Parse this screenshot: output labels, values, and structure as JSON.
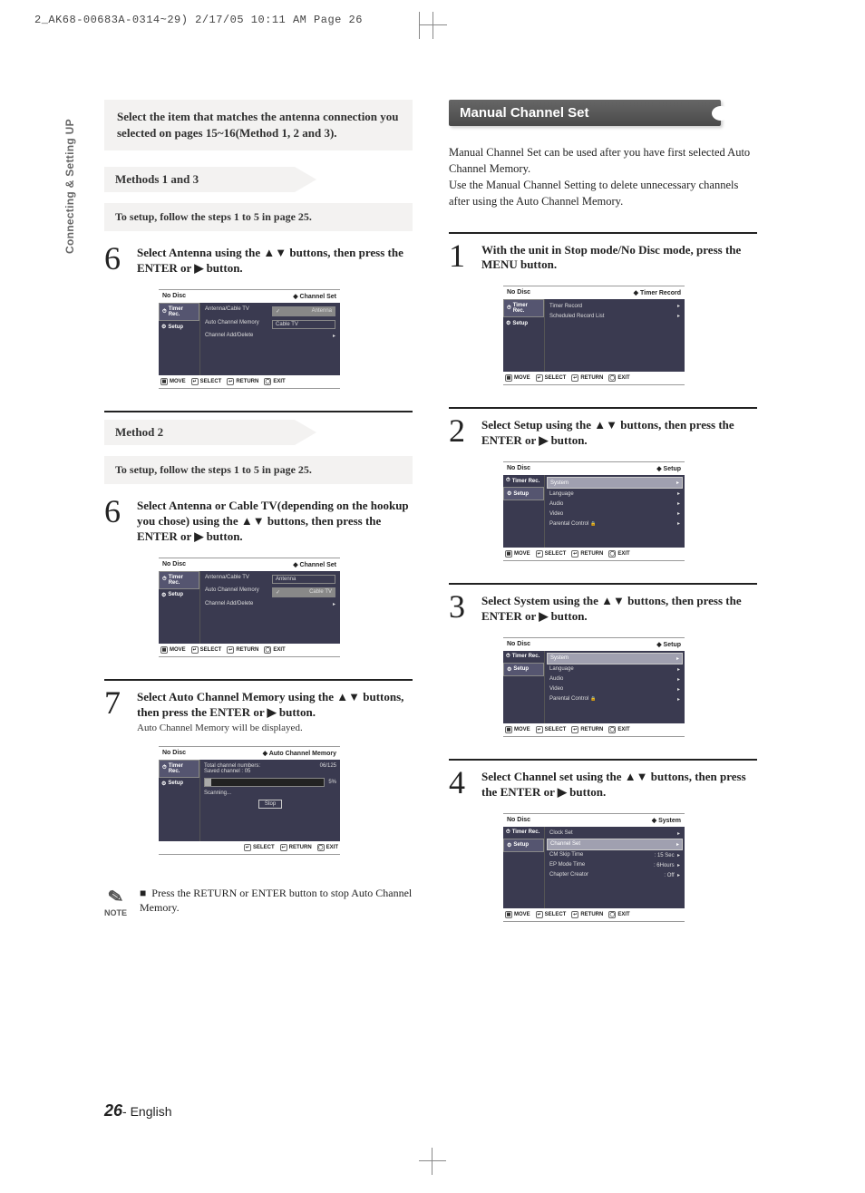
{
  "print_header": "2_AK68-00683A-0314~29)  2/17/05  10:11 AM  Page 26",
  "side_tab": "Connecting & Setting UP",
  "left": {
    "intro": "Select the item that matches the antenna connection you selected on pages 15~16(Method 1, 2 and 3).",
    "methods13": "Methods 1 and 3",
    "setup_note": "To setup, follow the steps 1 to 5 in page 25.",
    "step6a": "Select Antenna using the ▲▼ buttons, then press the ENTER or ▶ button.",
    "method2": "Method 2",
    "setup_note2": "To setup, follow the steps 1 to 5 in page 25.",
    "step6b": "Select Antenna or Cable TV(depending on the hookup you chose) using the ▲▼ buttons, then press the ENTER or ▶ button.",
    "step7": "Select Auto Channel Memory using the ▲▼ buttons, then press the ENTER or ▶ button.",
    "step7_sub": "Auto Channel Memory will be displayed.",
    "osd_channel": {
      "title_left": "No Disc",
      "title_right": "Channel Set",
      "side": [
        "Timer Rec.",
        "Setup"
      ],
      "rows": [
        {
          "label": "Antenna/Cable TV",
          "value": "Antenna",
          "hl": true
        },
        {
          "label": "Auto Channel Memory",
          "value": "Cable TV"
        },
        {
          "label": "Channel Add/Delete",
          "value": ""
        }
      ],
      "foot": "MOVE   SELECT   RETURN   EXIT"
    },
    "osd_channel2": {
      "title_left": "No Disc",
      "title_right": "Channel Set",
      "side": [
        "Timer Rec.",
        "Setup"
      ],
      "rows": [
        {
          "label": "Antenna/Cable TV",
          "value": "Antenna"
        },
        {
          "label": "Auto Channel Memory",
          "value": "Cable TV",
          "hl": true
        },
        {
          "label": "Channel Add/Delete",
          "value": ""
        }
      ]
    },
    "osd_auto": {
      "title_left": "No Disc",
      "title_right": "Auto Channel Memory",
      "side": [
        "Timer Rec.",
        "Setup"
      ],
      "total": "Total channel numbers:",
      "total_val": "06/125",
      "saved": "Saved channel :   05",
      "percent": "5%",
      "scanning": "Scanning...",
      "stop": "Stop",
      "foot": "SELECT   RETURN   EXIT"
    },
    "note_label": "NOTE",
    "note_text": "Press the RETURN or ENTER button to stop Auto Channel Memory."
  },
  "right": {
    "heading": "Manual Channel Set",
    "para1": "Manual Channel Set can be used after you have first selected Auto Channel Memory.",
    "para2": "Use the Manual Channel Setting to delete unnecessary channels after using the Auto Channel Memory.",
    "step1": "With the unit in Stop mode/No Disc mode, press the MENU button.",
    "osd_timer": {
      "title_left": "No Disc",
      "title_right": "Timer Record",
      "side": [
        "Timer Rec.",
        "Setup"
      ],
      "rows": [
        "Timer Record",
        "Scheduled Record List"
      ]
    },
    "step2": "Select Setup using the ▲▼ buttons, then press the ENTER or ▶ button.",
    "osd_setup": {
      "title_left": "No Disc",
      "title_right": "Setup",
      "side": [
        "Timer Rec.",
        "Setup"
      ],
      "rows": [
        "System",
        "Language",
        "Audio",
        "Video",
        "Parental Control"
      ]
    },
    "step3": "Select System using the ▲▼ buttons, then press the ENTER or ▶ button.",
    "step4": "Select Channel set using the ▲▼ buttons, then press the ENTER or ▶ button.",
    "osd_system": {
      "title_left": "No Disc",
      "title_right": "System",
      "side": [
        "Timer Rec.",
        "Setup"
      ],
      "rows": [
        {
          "label": "Clock Set",
          "value": ""
        },
        {
          "label": "Channel Set",
          "value": "",
          "hl": true
        },
        {
          "label": "CM Skip Time",
          "value": ": 15 Sec"
        },
        {
          "label": "EP Mode Time",
          "value": ": 6Hours"
        },
        {
          "label": "Chapter Creator",
          "value": ": Off"
        }
      ]
    },
    "foot_labels": {
      "move": "MOVE",
      "select": "SELECT",
      "return": "RETURN",
      "exit": "EXIT"
    }
  },
  "footer": {
    "page": "26",
    "sep": "- ",
    "lang": "English"
  }
}
